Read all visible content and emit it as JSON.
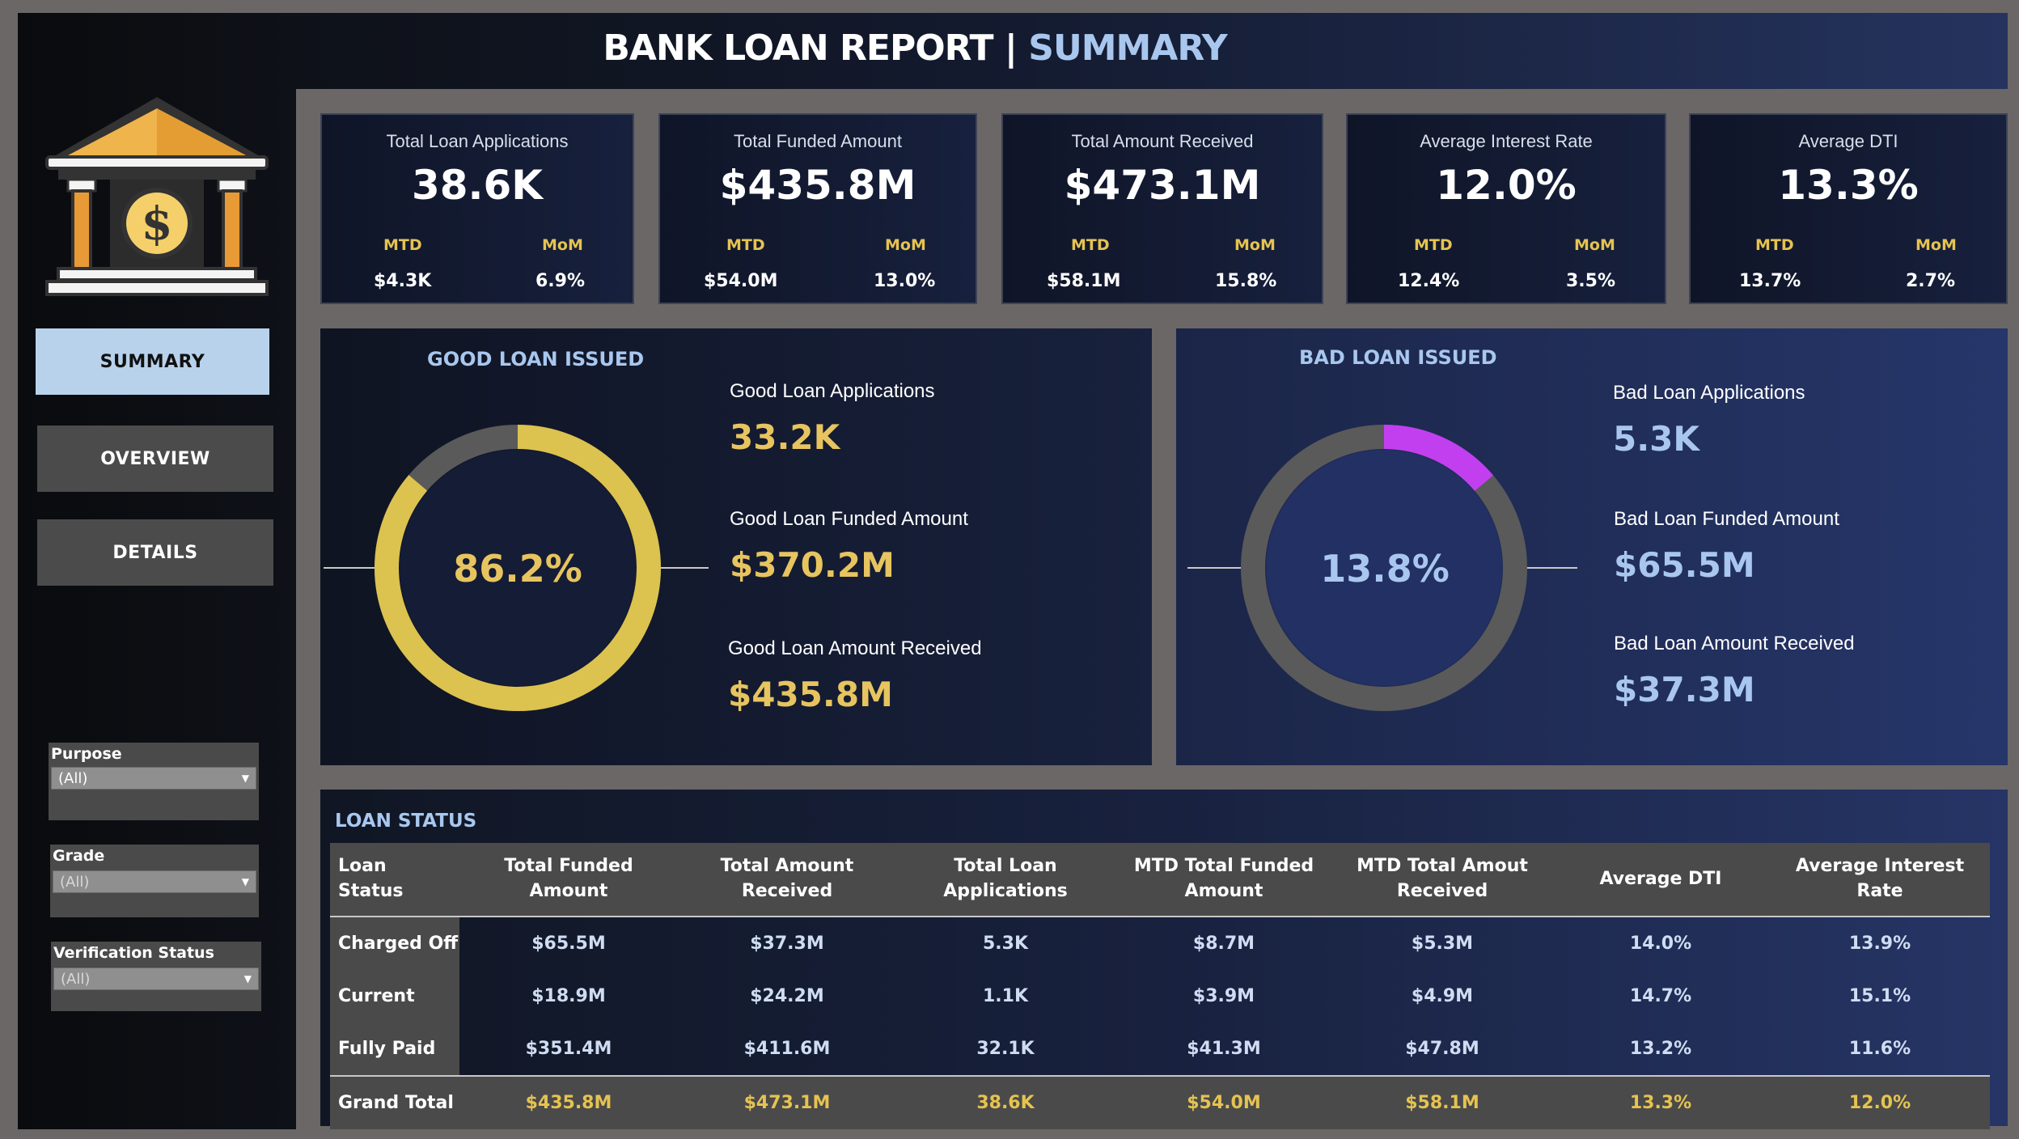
{
  "header": {
    "title_main": "BANK LOAN REPORT |",
    "title_accent": "SUMMARY"
  },
  "nav": {
    "summary": "SUMMARY",
    "overview": "OVERVIEW",
    "details": "DETAILS",
    "active": "SUMMARY"
  },
  "filters": [
    {
      "label": "Purpose",
      "value": "(All)"
    },
    {
      "label": "Grade",
      "value": "(All)"
    },
    {
      "label": "Verification Status",
      "value": "(All)"
    }
  ],
  "kpis": [
    {
      "title": "Total Loan Applications",
      "value": "38.6K",
      "mtd_label": "MTD",
      "mtd": "$4.3K",
      "mom_label": "MoM",
      "mom": "6.9%"
    },
    {
      "title": "Total Funded Amount",
      "value": "$435.8M",
      "mtd_label": "MTD",
      "mtd": "$54.0M",
      "mom_label": "MoM",
      "mom": "13.0%"
    },
    {
      "title": "Total Amount Received",
      "value": "$473.1M",
      "mtd_label": "MTD",
      "mtd": "$58.1M",
      "mom_label": "MoM",
      "mom": "15.8%"
    },
    {
      "title": "Average Interest Rate",
      "value": "12.0%",
      "mtd_label": "MTD",
      "mtd": "12.4%",
      "mom_label": "MoM",
      "mom": "3.5%"
    },
    {
      "title": "Average DTI",
      "value": "13.3%",
      "mtd_label": "MTD",
      "mtd": "13.7%",
      "mom_label": "MoM",
      "mom": "2.7%"
    }
  ],
  "good_loan": {
    "title": "GOOD LOAN ISSUED",
    "percent_label": "86.2%",
    "percent": 86.2,
    "applications_label": "Good Loan Applications",
    "applications": "33.2K",
    "funded_label": "Good Loan Funded Amount",
    "funded": "$370.2M",
    "received_label": "Good Loan Amount Received",
    "received": "$435.8M",
    "color": "#dcc24f"
  },
  "bad_loan": {
    "title": "BAD LOAN ISSUED",
    "percent_label": "13.8%",
    "percent": 13.8,
    "applications_label": "Bad Loan Applications",
    "applications": "5.3K",
    "funded_label": "Bad Loan Funded Amount",
    "funded": "$65.5M",
    "received_label": "Bad Loan Amount Received",
    "received": "$37.3M",
    "color": "#c23ff0"
  },
  "loan_status": {
    "title": "LOAN STATUS",
    "columns": [
      "Loan Status",
      "Total Funded Amount",
      "Total Amount Received",
      "Total Loan Applications",
      "MTD Total Funded Amount",
      "MTD Total Amout Received",
      "Average DTI",
      "Average Interest Rate"
    ],
    "rows": [
      [
        "Charged Off",
        "$65.5M",
        "$37.3M",
        "5.3K",
        "$8.7M",
        "$5.3M",
        "14.0%",
        "13.9%"
      ],
      [
        "Current",
        "$18.9M",
        "$24.2M",
        "1.1K",
        "$3.9M",
        "$4.9M",
        "14.7%",
        "15.1%"
      ],
      [
        "Fully Paid",
        "$351.4M",
        "$411.6M",
        "32.1K",
        "$41.3M",
        "$47.8M",
        "13.2%",
        "11.6%"
      ]
    ],
    "total": [
      "Grand Total",
      "$435.8M",
      "$473.1M",
      "38.6K",
      "$54.0M",
      "$58.1M",
      "13.3%",
      "12.0%"
    ]
  }
}
